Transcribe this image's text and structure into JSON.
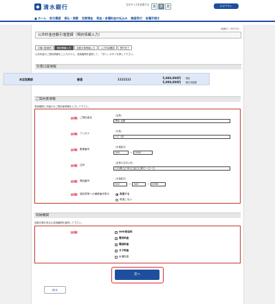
{
  "header": {
    "bank_name": "清水銀行",
    "fontsize_label": "文字サイズを変更する",
    "fontsize_buttons": [
      "あ",
      "あ",
      "あ"
    ],
    "logout": "ログアウト"
  },
  "nav": {
    "items": [
      "ホーム",
      "取引履歴",
      "振込・振替",
      "定期預金",
      "税金・各種料金の払込み",
      "諸届受付",
      "各種手続き"
    ]
  },
  "screen_id": "画面ID：BKT002",
  "page_title": "公共料金自動引落登録（契約情報入力）",
  "steps": [
    "引落口座選択",
    "契約情報入力",
    "自動引落情報入力",
    "入力内容確認",
    "受付完了"
  ],
  "current_step": 1,
  "step_note": "公共料金のご契約情報をご入力のうえ、収納機関を選択して、「次へ」ボタンを押して下さい。",
  "account_section": {
    "title": "引落口座情報",
    "branch": "本店営業部",
    "type": "普通",
    "number": "1111111",
    "balance": "5,000,000円",
    "balance_label": "残高",
    "available": "5,000,000円",
    "available_label": "取引可能額"
  },
  "contract_section": {
    "title": "ご契約者情報",
    "hint": "収納機関にお届けのご契約者情報を入力して下さい。",
    "required_label": "【必須】",
    "name_label": "ご契約者名",
    "name_note": "（全角）",
    "name_value": "清水 太郎",
    "kana_label": "フリガナ",
    "kana_note": "（半角）",
    "kana_value": "ｼﾐｽﾞ ﾀﾛｳ",
    "zip_label": "郵便番号",
    "zip_note": "（半角数字）",
    "zip1": "000",
    "zip2": "0000",
    "address_label": "住所",
    "address_note": "（全角32文字以内）",
    "address_value": "〇〇県〇〇市〇〇区〇〇町〇ー〇ー〇",
    "phone_label": "電話番号",
    "phone_note": "（半角数字）",
    "phone1": "012",
    "phone2": "345",
    "phone3": "6789",
    "dash": "ー",
    "notify_label": "領収書等への通帳番号表示",
    "notify_yes": "希望する",
    "notify_no": "希望しない"
  },
  "agency_section": {
    "title": "収納機関",
    "hint": "自動引落を申込む収納機関を選択して下さい。",
    "required_label": "【必須】",
    "items": [
      {
        "label": "NHK受信料",
        "checked": "✓"
      },
      {
        "label": "電気料金",
        "checked": "✓"
      },
      {
        "label": "電話料金",
        "checked": "✓"
      },
      {
        "label": "ガス料金",
        "checked": "✓"
      },
      {
        "label": "水道料金",
        "checked": ""
      }
    ]
  },
  "buttons": {
    "next": "次へ",
    "back": "戻る"
  },
  "colors": {
    "brand": "#1d4f9c",
    "required": "#d0021b",
    "highlight": "#e0262a"
  }
}
